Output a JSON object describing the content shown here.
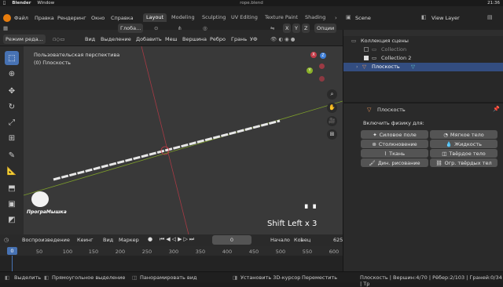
{
  "macos": {
    "app": "Blender",
    "menu_window": "Window",
    "file_title": "rope.blend",
    "clock": "21:36"
  },
  "menu": {
    "items": [
      "Файл",
      "Правка",
      "Рендеринг",
      "Окно",
      "Справка"
    ]
  },
  "workspaces": [
    "Layout",
    "Modeling",
    "Sculpting",
    "UV Editing",
    "Texture Paint",
    "Shading"
  ],
  "scene": {
    "label": "Scene",
    "view_layer": "View Layer"
  },
  "header": {
    "mode": "Режим реда...",
    "menus": [
      "Вид",
      "Выделение",
      "Добавить",
      "Меш",
      "Вершина",
      "Ребро",
      "Грань",
      "УФ"
    ],
    "transform": "Глоба...",
    "options": "Опции",
    "axes": [
      "X",
      "Y",
      "Z"
    ]
  },
  "viewport": {
    "perspective": "Пользовательская перспектива",
    "object": "(0) Плоскость",
    "keypress": "Shift Left x 3",
    "logo_text": "ПрограМышка",
    "gizmo": {
      "x": "X",
      "y": "Y",
      "z": "Z"
    }
  },
  "outliner": {
    "collection": "Коллекция сцены",
    "items": [
      "Collection",
      "Collection 2",
      "Плоскость"
    ]
  },
  "properties": {
    "object_name": "Плоскость",
    "physics_label": "Включить физику для:",
    "buttons": [
      "Силовое поле",
      "Мягкое тело",
      "Столкновение",
      "Жидкость",
      "Ткань",
      "Твёрдое тело",
      "Дин. рисование",
      "Огр. твёрдых тел"
    ]
  },
  "timeline": {
    "playback": "Воспроизведение",
    "keying": "Кеинг",
    "view": "Вид",
    "marker": "Маркер",
    "current_frame": "0",
    "start_label": "Начало",
    "start": "1",
    "end_label": "Конец",
    "end": "625",
    "ruler": [
      "0",
      "50",
      "100",
      "150",
      "200",
      "250",
      "300",
      "350",
      "400",
      "450",
      "500",
      "550",
      "600"
    ]
  },
  "status": {
    "select": "Выделить",
    "box_select": "Прямоугольное выделение",
    "pan": "Панорамировать вид",
    "cursor": "Установить 3D-курсор",
    "move": "Переместить",
    "stats": "Плоскость | Вершин:4/70 | Рёбер:2/103 | Граней:0/34 | Тр"
  },
  "colors": {
    "accent": "#4772b3",
    "viewport_bg": "#393939",
    "axis_x": "#c43b48",
    "axis_y": "#8ab128",
    "axis_z": "#3d7ed8",
    "mesh": "#e8e8e8"
  }
}
